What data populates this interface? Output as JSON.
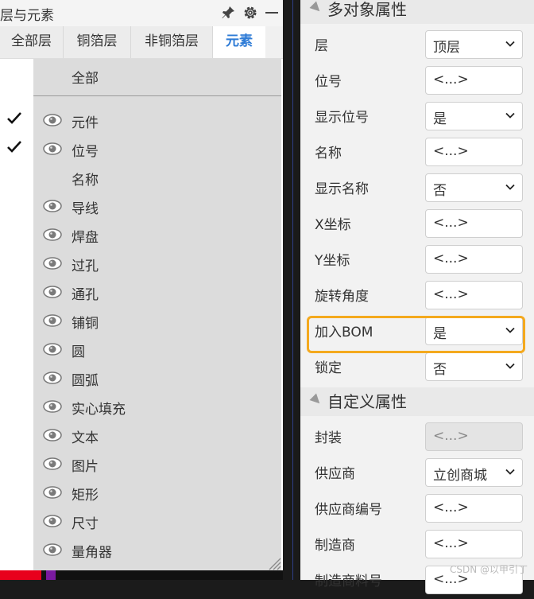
{
  "left_panel": {
    "title": "层与元素",
    "header_icons": [
      "pin-icon",
      "gear-icon",
      "minimize-icon"
    ],
    "tabs": [
      {
        "label": "全部层",
        "active": false
      },
      {
        "label": "铜箔层",
        "active": false
      },
      {
        "label": "非铜箔层",
        "active": false
      },
      {
        "label": "元素",
        "active": true
      }
    ],
    "all_label": "全部",
    "items": [
      {
        "label": "元件",
        "checked": true,
        "visible": true
      },
      {
        "label": "位号",
        "checked": true,
        "visible": true
      },
      {
        "label": "名称",
        "checked": false,
        "visible": false
      },
      {
        "label": "导线",
        "checked": false,
        "visible": true
      },
      {
        "label": "焊盘",
        "checked": false,
        "visible": true
      },
      {
        "label": "过孔",
        "checked": false,
        "visible": true
      },
      {
        "label": "通孔",
        "checked": false,
        "visible": true
      },
      {
        "label": "铺铜",
        "checked": false,
        "visible": true
      },
      {
        "label": "圆",
        "checked": false,
        "visible": true
      },
      {
        "label": "圆弧",
        "checked": false,
        "visible": true
      },
      {
        "label": "实心填充",
        "checked": false,
        "visible": true
      },
      {
        "label": "文本",
        "checked": false,
        "visible": true
      },
      {
        "label": "图片",
        "checked": false,
        "visible": true
      },
      {
        "label": "矩形",
        "checked": false,
        "visible": true
      },
      {
        "label": "尺寸",
        "checked": false,
        "visible": true
      },
      {
        "label": "量角器",
        "checked": false,
        "visible": true
      }
    ]
  },
  "right_panel": {
    "sections": [
      {
        "title": "多对象属性",
        "props": [
          {
            "label": "层",
            "value": "顶层",
            "type": "select"
          },
          {
            "label": "位号",
            "value": "<...>",
            "type": "input"
          },
          {
            "label": "显示位号",
            "value": "是",
            "type": "select"
          },
          {
            "label": "名称",
            "value": "<...>",
            "type": "input"
          },
          {
            "label": "显示名称",
            "value": "否",
            "type": "select"
          },
          {
            "label": "X坐标",
            "value": "<...>",
            "type": "input"
          },
          {
            "label": "Y坐标",
            "value": "<...>",
            "type": "input"
          },
          {
            "label": "旋转角度",
            "value": "<...>",
            "type": "input"
          },
          {
            "label": "加入BOM",
            "value": "是",
            "type": "select",
            "highlighted": true
          },
          {
            "label": "锁定",
            "value": "否",
            "type": "select"
          }
        ]
      },
      {
        "title": "自定义属性",
        "props": [
          {
            "label": "封装",
            "value": "<...>",
            "type": "input",
            "disabled": true
          },
          {
            "label": "供应商",
            "value": "立创商城",
            "type": "select"
          },
          {
            "label": "供应商编号",
            "value": "<...>",
            "type": "input"
          },
          {
            "label": "制造商",
            "value": "<...>",
            "type": "input"
          },
          {
            "label": "制造商料号",
            "value": "<...>",
            "type": "input"
          }
        ]
      }
    ]
  },
  "watermark": "CSDN @以甲引丁",
  "colors": {
    "accent": "#2e7bd6",
    "highlight": "#f4a91e",
    "red_bar": "#e8001c",
    "purple_bar": "#7a1aa0"
  }
}
